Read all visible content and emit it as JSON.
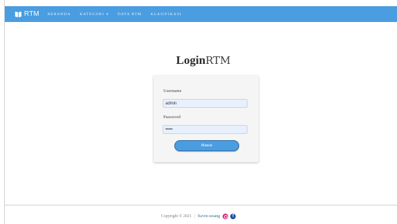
{
  "navbar": {
    "brand": "RTM",
    "items": [
      {
        "label": "BERANDA"
      },
      {
        "label": "KATEGORI",
        "caret": "▾"
      },
      {
        "label": "DATA RTM"
      },
      {
        "label": "KLASIFIKASI"
      }
    ]
  },
  "page_title": {
    "bold": "Login",
    "rest": "RTM"
  },
  "login": {
    "username_label": "Username",
    "username_value": "admin",
    "password_label": "Password",
    "password_value": "•••••",
    "submit_label": "Masuk"
  },
  "footer": {
    "copyright": "Copyright © 2021",
    "separator": "|",
    "author": "Kevin sesang",
    "social_icons": [
      "instagram-icon",
      "facebook-icon"
    ]
  },
  "colors": {
    "navbar": "#4a9de0",
    "button": "#4a9de0",
    "input_bg": "#e8f0fe"
  }
}
